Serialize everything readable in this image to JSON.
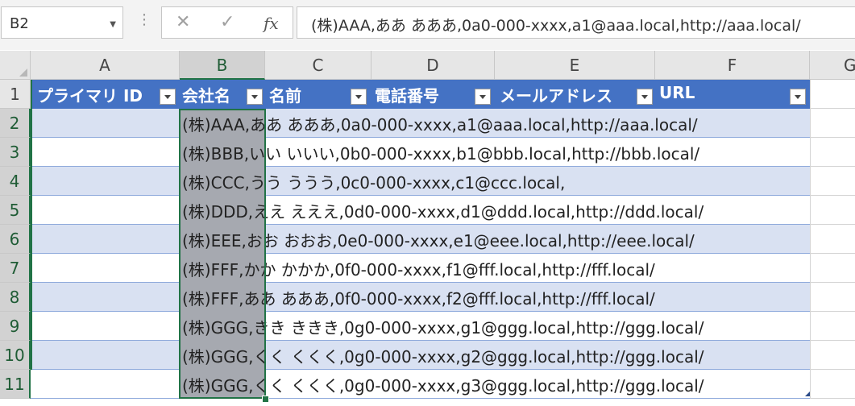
{
  "formula_bar": {
    "name_box": "B2",
    "cancel_icon": "✕",
    "enter_icon": "✓",
    "fx_label": "fx",
    "content": "(株)AAA,ああ あああ,0a0-000-xxxx,a1@aaa.local,http://aaa.local/"
  },
  "columns": [
    "A",
    "B",
    "C",
    "D",
    "E",
    "F",
    "G"
  ],
  "row_numbers": [
    "1",
    "2",
    "3",
    "4",
    "5",
    "6",
    "7",
    "8",
    "9",
    "10",
    "11"
  ],
  "table": {
    "headers": [
      "プライマリ ID",
      "会社名",
      "名前",
      "電話番号",
      "メールアドレス",
      "URL"
    ],
    "rows": [
      "(株)AAA,ああ あああ,0a0-000-xxxx,a1@aaa.local,http://aaa.local/",
      "(株)BBB,いい いいい,0b0-000-xxxx,b1@bbb.local,http://bbb.local/",
      "(株)CCC,うう ううう,0c0-000-xxxx,c1@ccc.local,",
      "(株)DDD,ええ えええ,0d0-000-xxxx,d1@ddd.local,http://ddd.local/",
      "(株)EEE,おお おおお,0e0-000-xxxx,e1@eee.local,http://eee.local/",
      "(株)FFF,かか かかか,0f0-000-xxxx,f1@fff.local,http://fff.local/",
      "(株)FFF,ああ あああ,0f0-000-xxxx,f2@fff.local,http://fff.local/",
      "(株)GGG,きき ききき,0g0-000-xxxx,g1@ggg.local,http://ggg.local/",
      "(株)GGG,くく くくく,0g0-000-xxxx,g2@ggg.local,http://ggg.local/",
      "(株)GGG,くく くくく,0g0-000-xxxx,g3@ggg.local,http://ggg.local/"
    ]
  },
  "colors": {
    "header_blue": "#4472c4",
    "band_light": "#d9e1f2",
    "selection_green": "#217346",
    "selected_cell_gray": "#a6a9b0"
  }
}
